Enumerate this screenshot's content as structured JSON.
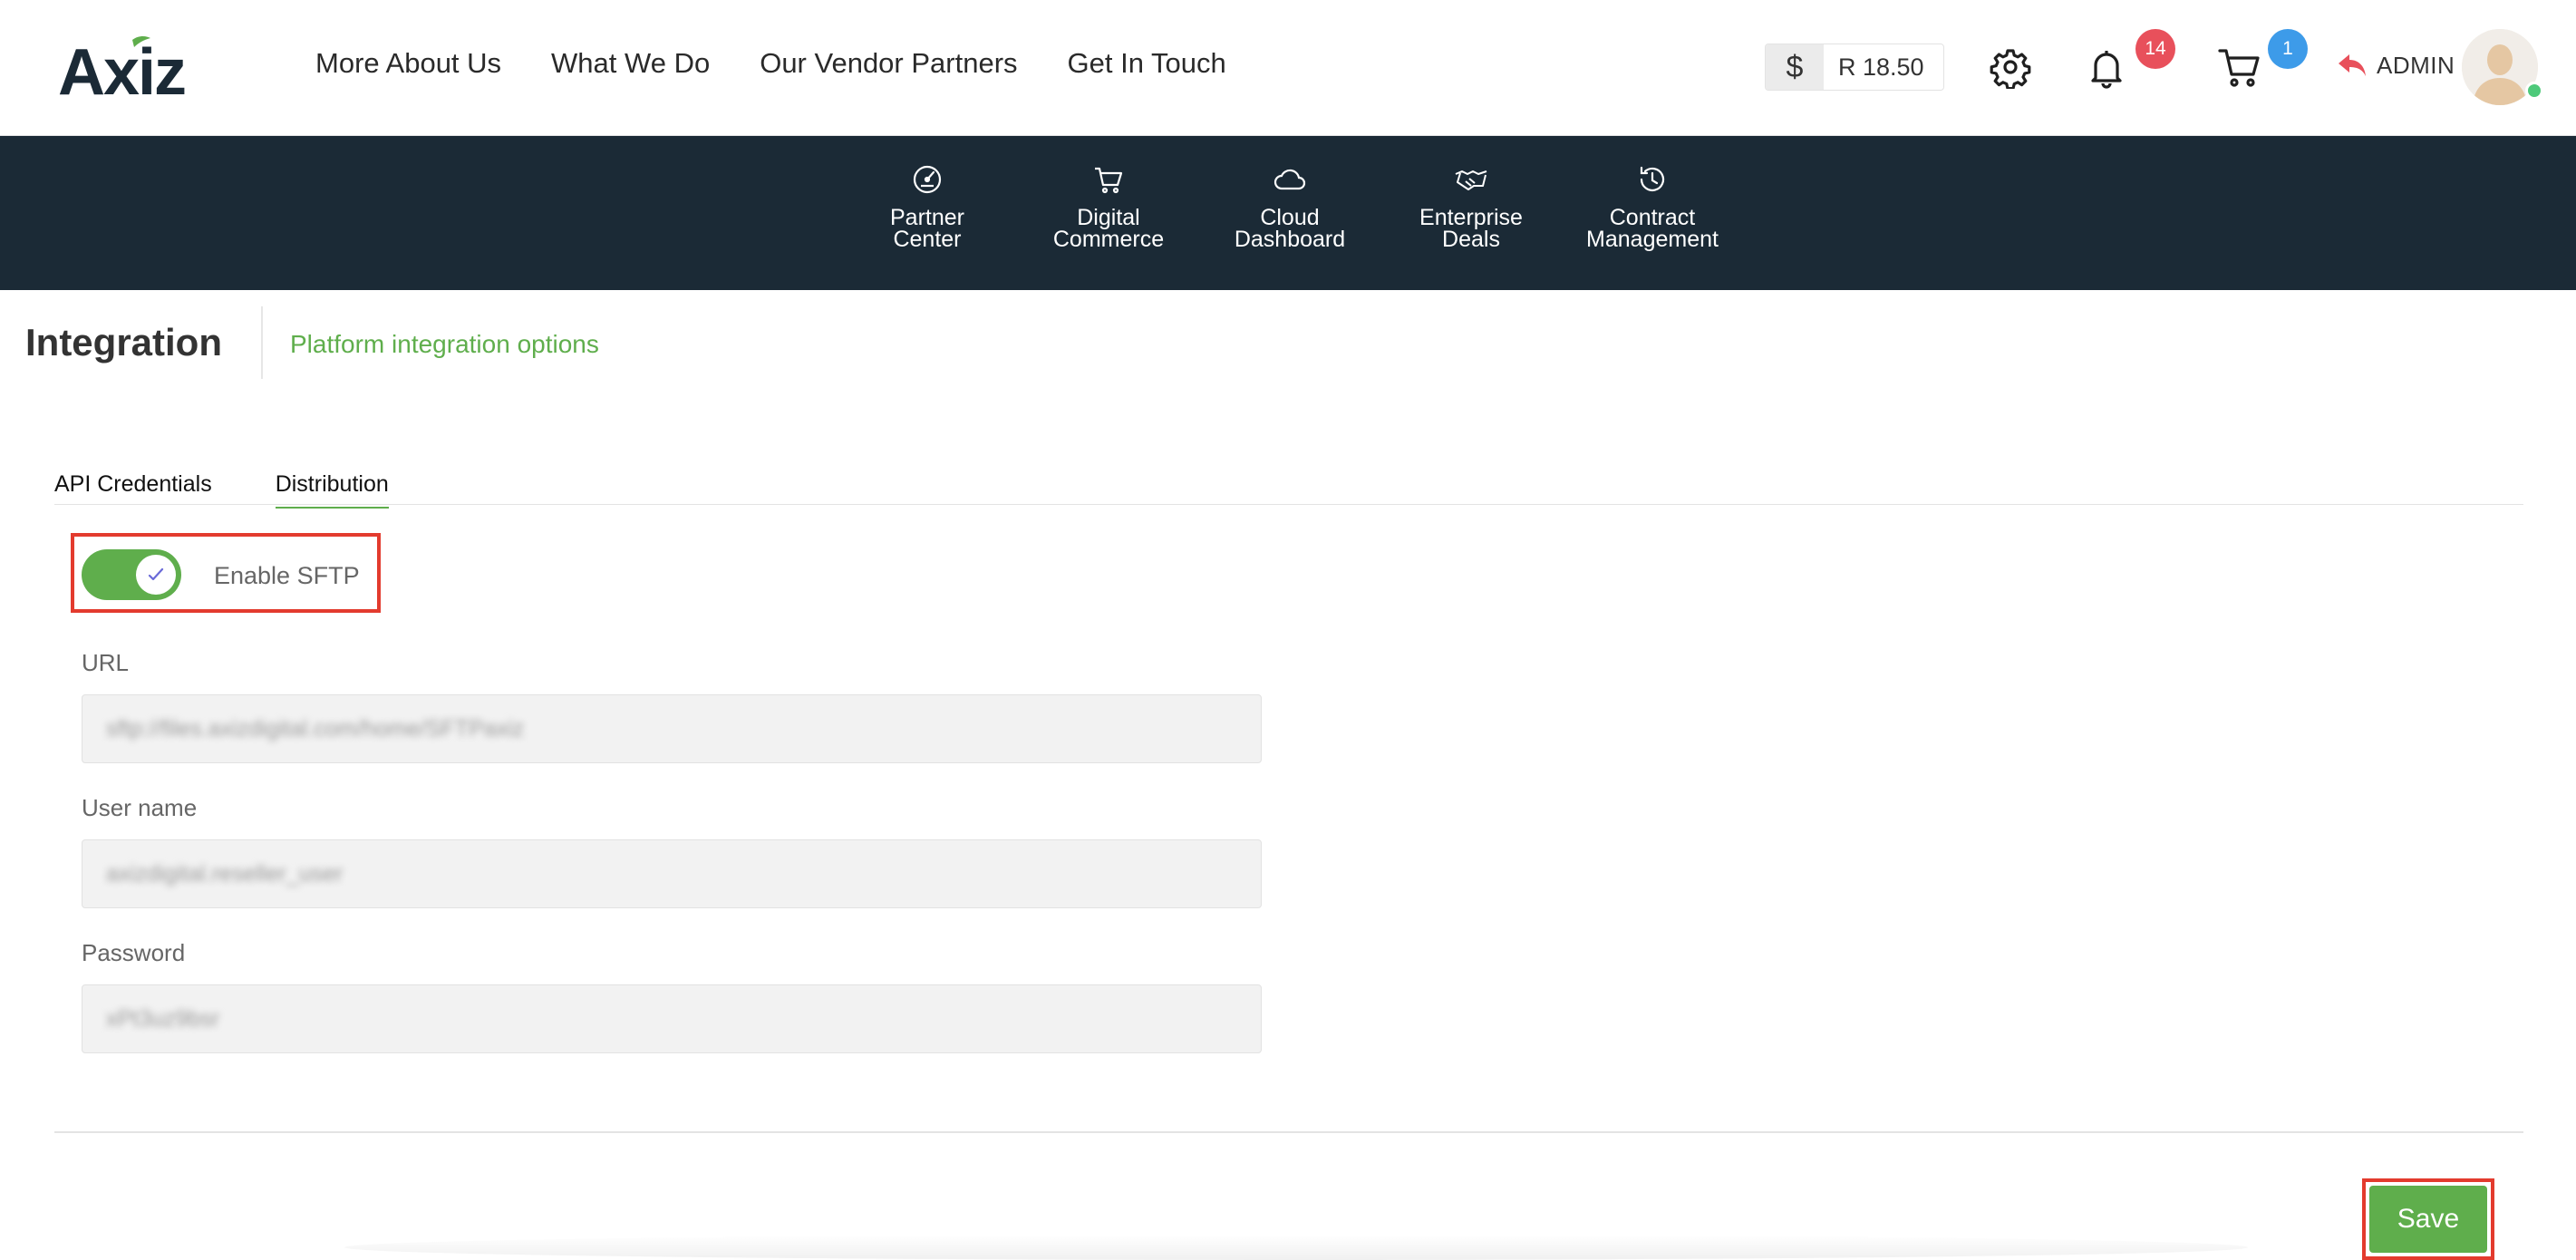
{
  "brand": {
    "logo_text": "Axiz",
    "logo_accent": "#5fae4c",
    "logo_color": "#1b2a36"
  },
  "main_nav": [
    {
      "label": "More About Us"
    },
    {
      "label": "What We Do"
    },
    {
      "label": "Our Vendor Partners"
    },
    {
      "label": "Get In Touch"
    }
  ],
  "header": {
    "currency_symbol": "$",
    "balance": "R 18.50",
    "notifications_count": "14",
    "cart_count": "1",
    "user_label": "ADMIN",
    "icons": [
      "gear-icon",
      "bell-icon",
      "cart-icon",
      "reply-icon",
      "avatar"
    ]
  },
  "sub_nav": [
    {
      "line1": "Partner",
      "line2": "Center",
      "icon": "speedometer-icon"
    },
    {
      "line1": "Digital",
      "line2": "Commerce",
      "icon": "cart-icon"
    },
    {
      "line1": "Cloud",
      "line2": "Dashboard",
      "icon": "cloud-icon"
    },
    {
      "line1": "Enterprise",
      "line2": "Deals",
      "icon": "handshake-icon"
    },
    {
      "line1": "Contract",
      "line2": "Management",
      "icon": "history-icon"
    }
  ],
  "page": {
    "title": "Integration",
    "subtitle": "Platform integration options"
  },
  "tabs": [
    {
      "label": "API Credentials",
      "active": false
    },
    {
      "label": "Distribution",
      "active": true
    }
  ],
  "sftp": {
    "toggle_label": "Enable SFTP",
    "enabled": true
  },
  "form": {
    "url_label": "URL",
    "url_value": "sftp://files.axizdigital.com/home/SFTPaxiz",
    "username_label": "User name",
    "username_value": "axizdigital.reseller_user",
    "password_label": "Password",
    "password_value": "xPt3uz9bsr"
  },
  "actions": {
    "save_label": "Save"
  },
  "colors": {
    "accent_green": "#5fae4c",
    "navy": "#1b2a36",
    "badge_red": "#e8505b",
    "badge_blue": "#3d9be9",
    "highlight_red": "#e33b2e"
  }
}
